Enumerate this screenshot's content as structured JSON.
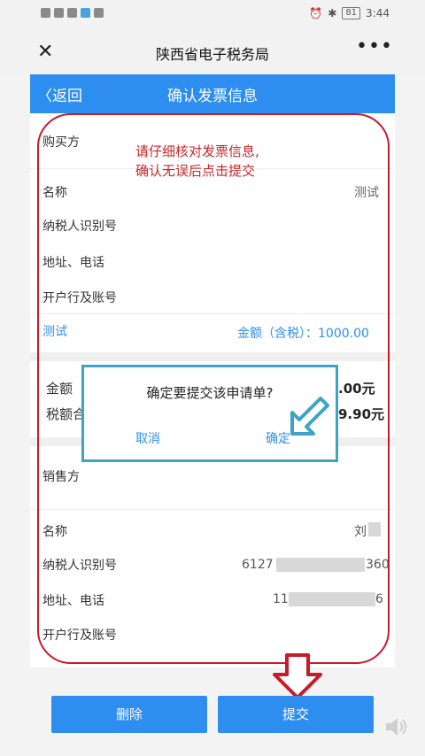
{
  "status_bar": {
    "battery": "81",
    "time": "3:44"
  },
  "wechat_bar": {
    "title": "陕西省电子税务局",
    "close_icon": "close-icon",
    "more_icon": "more-icon"
  },
  "header": {
    "back_label": "〈返回",
    "title": "确认发票信息"
  },
  "buyer": {
    "section_title": "购买方",
    "rows": [
      {
        "label": "名称",
        "value": "测试"
      },
      {
        "label": "纳税人识别号",
        "value": ""
      },
      {
        "label": "地址、电话",
        "value": ""
      },
      {
        "label": "开户行及账号",
        "value": ""
      }
    ],
    "item_name": "测试",
    "amount_text": "金额（含税）：1000.00"
  },
  "totals": {
    "amount_label": "金额",
    "amount_value": ".00元",
    "tax_label": "税额合",
    "tax_value": "9.90元"
  },
  "seller": {
    "section_title": "销售方",
    "rows": [
      {
        "label": "名称",
        "value": "刘"
      },
      {
        "label": "纳税人识别号",
        "value_prefix": "6127",
        "value_suffix": "360"
      },
      {
        "label": "地址、电话",
        "value_prefix": "11",
        "value_suffix": "6"
      },
      {
        "label": "开户行及账号",
        "value": ""
      }
    ]
  },
  "annotation": {
    "line1": "请仔细核对发票信息,",
    "line2": "确认无误后点击提交"
  },
  "dialog": {
    "message": "确定要提交该申请单?",
    "cancel": "取消",
    "confirm": "确定"
  },
  "buttons": {
    "delete": "删除",
    "submit": "提交"
  },
  "colors": {
    "primary": "#2e8ef0",
    "annotation_red": "#c51b2a",
    "dialog_border": "#3fa3c7"
  }
}
